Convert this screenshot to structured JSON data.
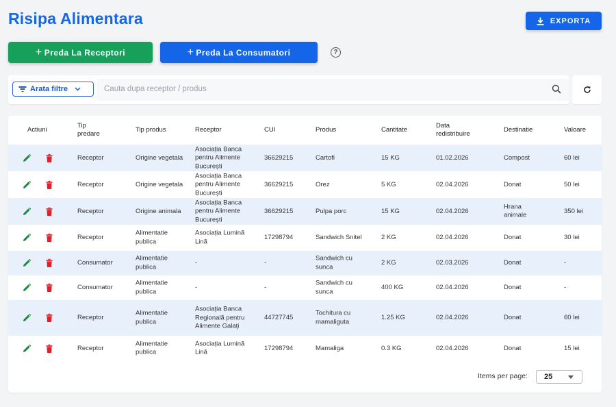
{
  "page": {
    "title": "Risipa Alimentara"
  },
  "toolbar": {
    "export_label": "EXPORTA",
    "export_icon": "download-icon",
    "give_receptors_label": "Preda La Receptori",
    "give_consumers_label": "Preda La Consumatori",
    "plus_symbol": "+",
    "help_symbol": "?",
    "colors": {
      "primary": "#1565e8",
      "success": "#16a05a"
    }
  },
  "filters": {
    "toggle_label": "Arata filtre",
    "search_placeholder": "Cauta dupa receptor / produs",
    "search_icon": "search-icon",
    "refresh_icon": "refresh-icon"
  },
  "table": {
    "columns": [
      "Actiuni",
      "Tip predare",
      "Tip produs",
      "Receptor",
      "CUI",
      "Produs",
      "Cantitate",
      "Data redistribuire",
      "Destinatie",
      "Valoare"
    ],
    "rows": [
      {
        "tip_predare": "Receptor",
        "tip_produs": "Origine vegetala",
        "receptor": "Asociația Banca pentru Alimente București",
        "cui": "36629215",
        "produs": "Cartofi",
        "cantitate": "15 KG",
        "data": "01.02.2026",
        "destinatie": "Compost",
        "valoare": "60 lei"
      },
      {
        "tip_predare": "Receptor",
        "tip_produs": "Origine vegetala",
        "receptor": "Asociația Banca pentru Alimente București",
        "cui": "36629215",
        "produs": "Orez",
        "cantitate": "5 KG",
        "data": "02.04.2026",
        "destinatie": "Donat",
        "valoare": "50 lei"
      },
      {
        "tip_predare": "Receptor",
        "tip_produs": "Origine animala",
        "receptor": "Asociația Banca pentru Alimente București",
        "cui": "36629215",
        "produs": "Pulpa porc",
        "cantitate": "15 KG",
        "data": "02.04.2026",
        "destinatie": "Hrana animale",
        "valoare": "350 lei"
      },
      {
        "tip_predare": "Receptor",
        "tip_produs": "Alimentatie publica",
        "receptor": "Asociația Lumină Lină",
        "cui": "17298794",
        "produs": "Sandwich Snitel",
        "cantitate": "2 KG",
        "data": "02.04.2026",
        "destinatie": "Donat",
        "valoare": "30 lei"
      },
      {
        "tip_predare": "Consumator",
        "tip_produs": "Alimentatie publica",
        "receptor": "-",
        "cui": "-",
        "produs": "Sandwich cu sunca",
        "cantitate": "2 KG",
        "data": "02.03.2026",
        "destinatie": "Donat",
        "valoare": "-"
      },
      {
        "tip_predare": "Consumator",
        "tip_produs": "Alimentatie publica",
        "receptor": "-",
        "cui": "-",
        "produs": "Sandwich cu sunca",
        "cantitate": "400 KG",
        "data": "02.04.2026",
        "destinatie": "Donat",
        "valoare": "-"
      },
      {
        "tip_predare": "Receptor",
        "tip_produs": "Alimentatie publica",
        "receptor": "Asociația Banca Regională pentru Alimente Galați",
        "cui": "44727745",
        "produs": "Tochitura cu mamaliguta",
        "cantitate": "1.25 KG",
        "data": "02.04.2026",
        "destinatie": "Donat",
        "valoare": "60 lei"
      },
      {
        "tip_predare": "Receptor",
        "tip_produs": "Alimentatie publica",
        "receptor": "Asociația Lumină Lină",
        "cui": "17298794",
        "produs": "Mamaliga",
        "cantitate": "0.3 KG",
        "data": "02.04.2026",
        "destinatie": "Donat",
        "valoare": "15 lei"
      }
    ],
    "row_icons": {
      "edit": "edit-icon",
      "delete": "delete-icon"
    },
    "colors": {
      "edit": "#1b8a3a",
      "delete": "#e0202a",
      "row_shade": "#e8f0fb"
    }
  },
  "pagination": {
    "label": "Items per page:",
    "value": "25"
  }
}
